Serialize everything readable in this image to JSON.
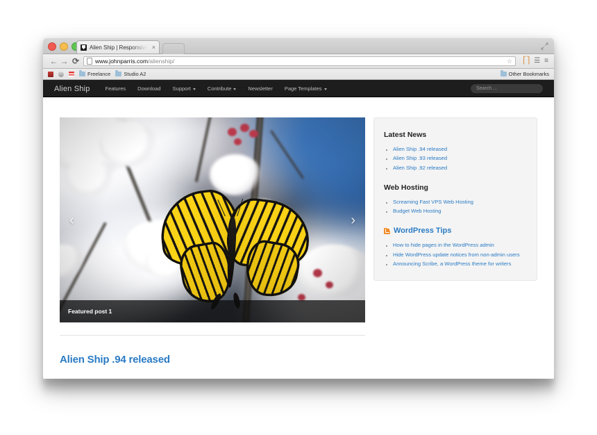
{
  "browser": {
    "window_controls": [
      "close",
      "minimize",
      "zoom"
    ],
    "tab": {
      "title": "Alien Ship | Responsive W",
      "close_label": "×",
      "favicon_name": "alien-ship-favicon"
    },
    "toolbar": {
      "back_label": "←",
      "forward_label": "→",
      "reload_label": "⟳",
      "url_host": "www.johnparris.com",
      "url_path": "/alienship/",
      "star_label": "☆",
      "pocket_label": "⚲",
      "extension_label": "≡",
      "menu_label": "≡"
    },
    "bookmarks": [
      {
        "label": "",
        "icon": "site-favicon-red"
      },
      {
        "label": "",
        "icon": "site-favicon-globe"
      },
      {
        "label": "",
        "icon": "site-favicon-striped"
      },
      {
        "label": "Freelance",
        "icon": "folder-icon"
      },
      {
        "label": "Studio A2",
        "icon": "folder-icon"
      }
    ],
    "other_bookmarks": {
      "label": "Other Bookmarks",
      "icon": "folder-icon"
    },
    "maximize_label": "⤡"
  },
  "site": {
    "brand": "Alien Ship",
    "nav": [
      {
        "label": "Features",
        "has_dropdown": false
      },
      {
        "label": "Download",
        "has_dropdown": false
      },
      {
        "label": "Support",
        "has_dropdown": true
      },
      {
        "label": "Contribute",
        "has_dropdown": true
      },
      {
        "label": "Newsletter",
        "has_dropdown": false
      },
      {
        "label": "Page Templates",
        "has_dropdown": true
      }
    ],
    "search": {
      "placeholder": "Search ..."
    },
    "nav_background": "#1d1d1d"
  },
  "slider": {
    "caption": "Featured post 1",
    "prev_label": "‹",
    "next_label": "›",
    "image_alt": "tiger-swallowtail-butterfly-on-cherry-blossoms"
  },
  "main": {
    "post_title": "Alien Ship .94 released",
    "link_color": "#2a7bc4"
  },
  "sidebar": {
    "widgets": [
      {
        "title": "Latest News",
        "rss": false,
        "items": [
          "Alien Ship .94 released",
          "Alien Ship .93 released",
          "Alien Ship .92 released"
        ]
      },
      {
        "title": "Web Hosting",
        "rss": false,
        "items": [
          "Screaming Fast VPS Web Hosting",
          "Budget Web Hosting"
        ]
      },
      {
        "title": "WordPress Tips",
        "rss": true,
        "rss_icon_color": "#f08a24",
        "items": [
          "How to hide pages in the WordPress admin",
          "Hide WordPress update notices from non-admin users",
          "Announcing Scribe, a WordPress theme for writers"
        ]
      }
    ]
  }
}
